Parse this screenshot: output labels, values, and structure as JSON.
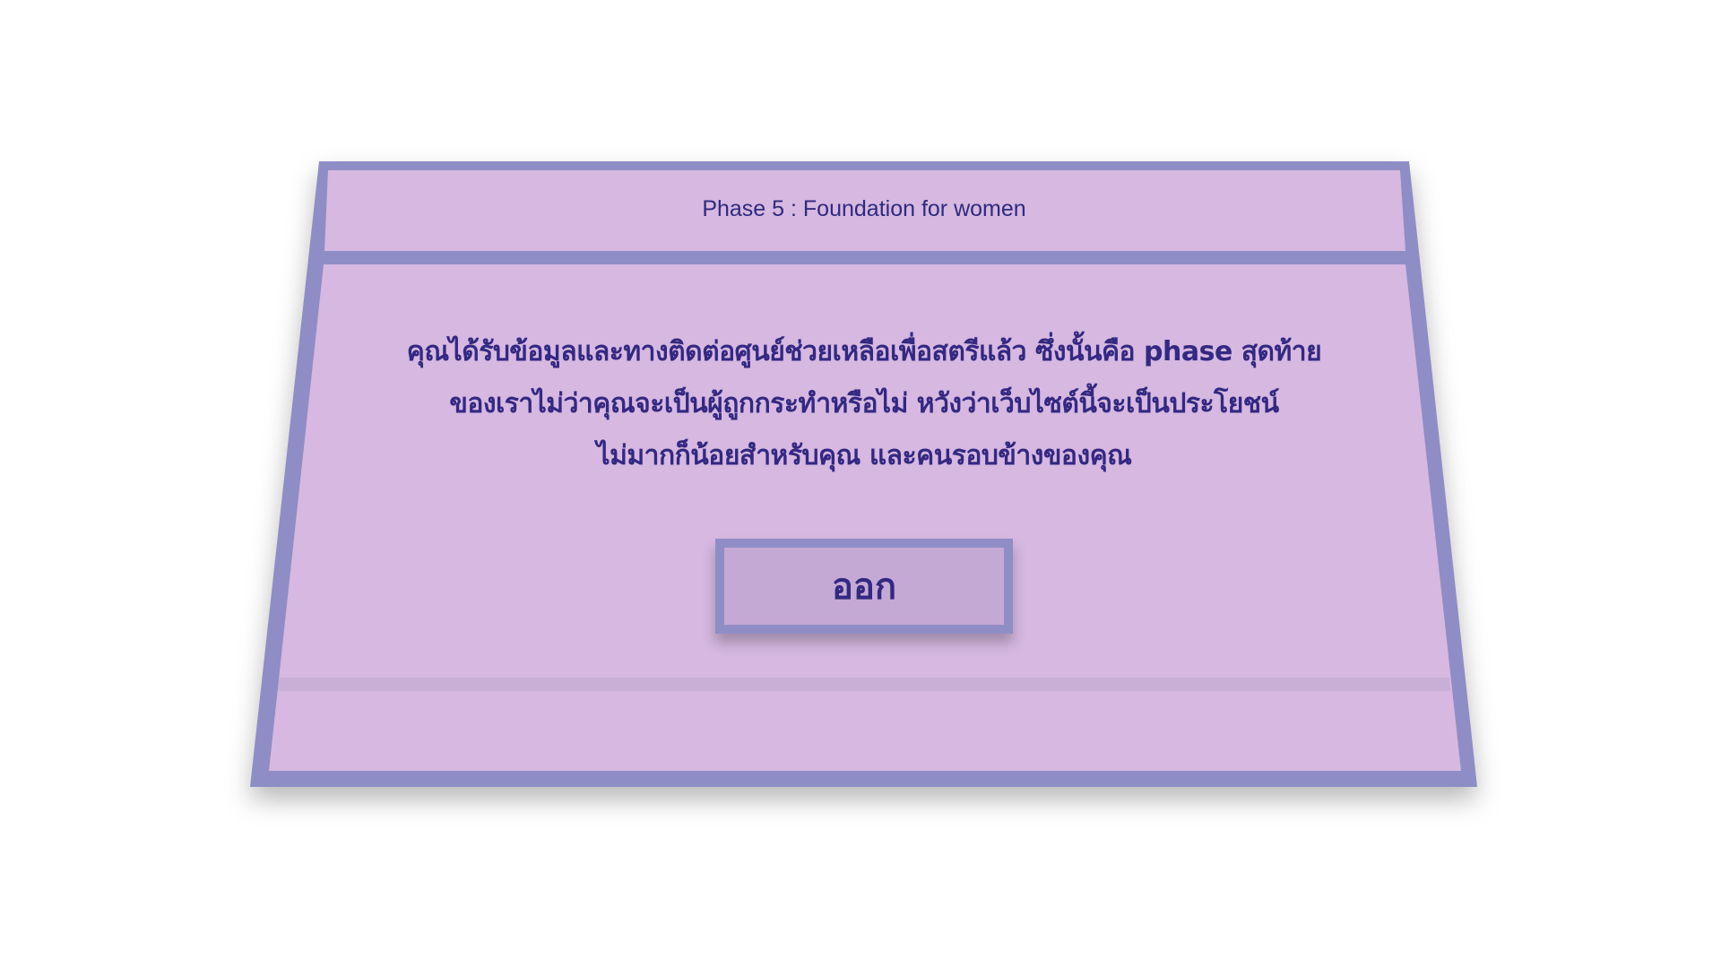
{
  "dialog": {
    "title": "Phase 5 : Foundation for women",
    "message_lines": [
      "คุณได้รับข้อมูลและทางติดต่อศูนย์ช่วยเหลือเพื่อสตรีแล้ว ซึ่งนั้นคือ phase สุดท้าย",
      "ของเราไม่ว่าคุณจะเป็นผู้ถูกกระทำหรือไม่ หวังว่าเว็บไซต์นี้จะเป็นประโยชน์",
      "ไม่มากก็น้อยสำหรับคุณ และคนรอบข้างของคุณ"
    ],
    "exit_label": "ออก"
  },
  "colors": {
    "frame": "#8f8dc6",
    "panel": "#d6b8e0",
    "text": "#332882",
    "button_bg": "#c4a9d4"
  }
}
